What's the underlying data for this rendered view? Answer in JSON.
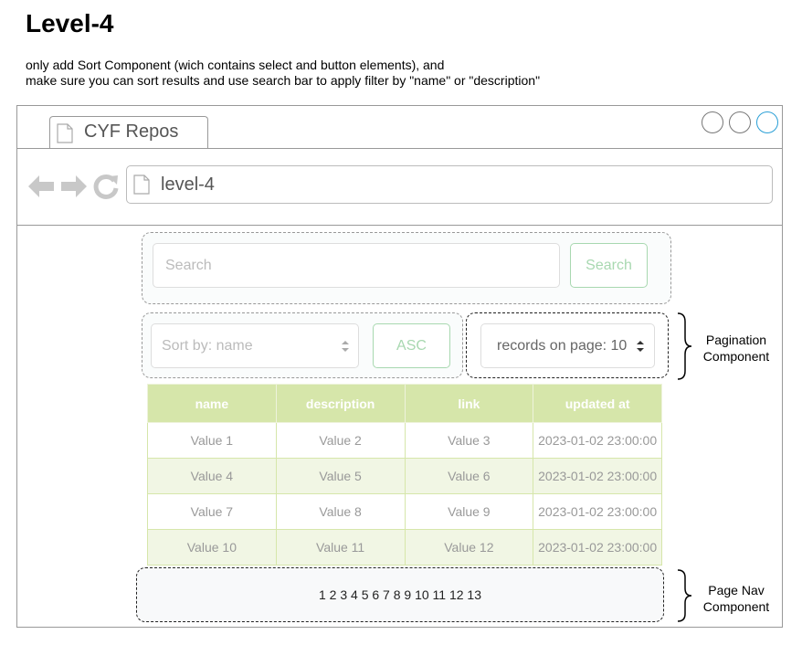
{
  "doc": {
    "heading": "Level-4",
    "description_line1": "only add Sort Component (wich contains select and button elements), and",
    "description_line2": "make sure you can sort results and use search bar to apply filter by \"name\" or \"description\""
  },
  "browser": {
    "tab_title": "CYF Repos",
    "url": "level-4"
  },
  "search": {
    "placeholder": "Search",
    "button_label": "Search"
  },
  "sort": {
    "select_value": "Sort by: name",
    "order_button": "ASC"
  },
  "pagination": {
    "records_select": "records on page: 10",
    "label_line1": "Pagination",
    "label_line2": "Component"
  },
  "table": {
    "headers": [
      "name",
      "description",
      "link",
      "updated at"
    ],
    "rows": [
      [
        "Value 1",
        "Value 2",
        "Value 3",
        "2023-01-02 23:00:00"
      ],
      [
        "Value 4",
        "Value 5",
        "Value 6",
        "2023-01-02 23:00:00"
      ],
      [
        "Value 7",
        "Value 8",
        "Value 9",
        "2023-01-02 23:00:00"
      ],
      [
        "Value 10",
        "Value 11",
        "Value 12",
        "2023-01-02 23:00:00"
      ]
    ]
  },
  "page_nav": {
    "pages": "1 2 3 4 5 6 7 8 9 10 11 12 13",
    "label_line1": "Page Nav",
    "label_line2": "Component"
  },
  "colors": {
    "header_green": "#d6e6aa",
    "row_alt": "#f1f6e4",
    "button_green": "#a8d8b0",
    "accent_circle": "#2a9fd6"
  }
}
